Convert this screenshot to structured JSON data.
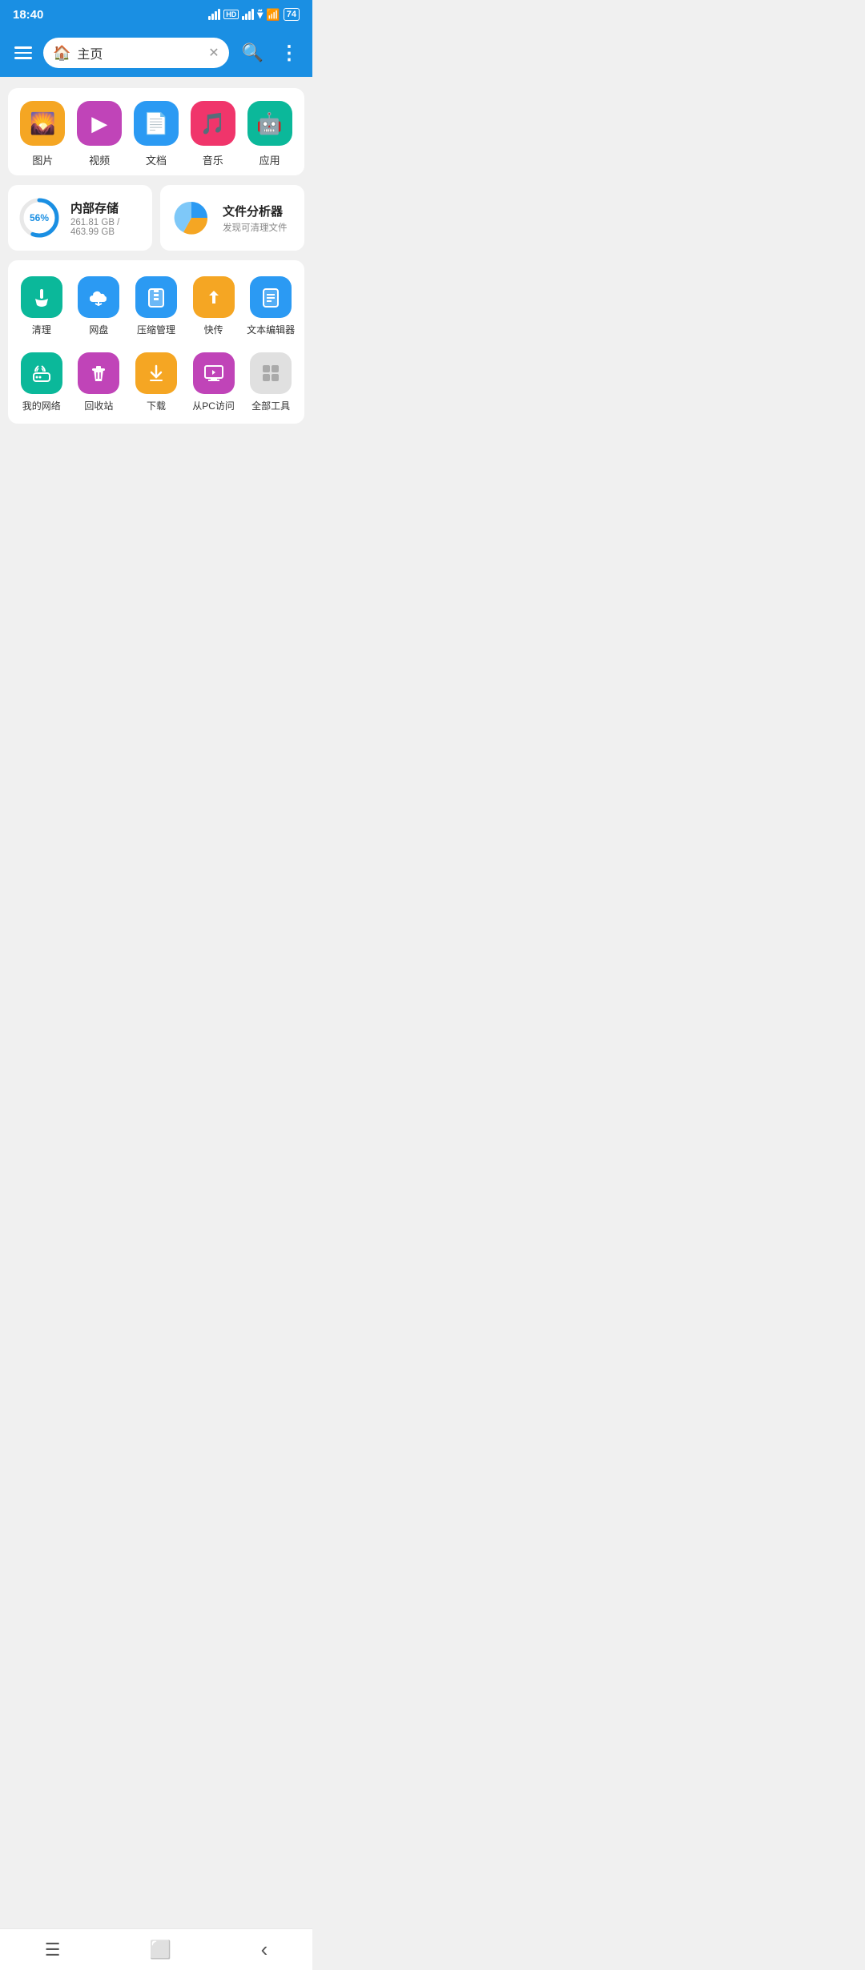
{
  "status": {
    "time": "18:40",
    "battery": "74"
  },
  "header": {
    "menu_label": "menu",
    "home_icon": "🏠",
    "home_label": "主页",
    "close_icon": "✕",
    "search_icon": "🔍",
    "more_icon": "⋮"
  },
  "file_types": [
    {
      "id": "images",
      "label": "图片",
      "icon": "🌄",
      "bg": "#F5A623"
    },
    {
      "id": "video",
      "label": "视频",
      "icon": "▶",
      "bg": "#C044B8"
    },
    {
      "id": "docs",
      "label": "文档",
      "icon": "📄",
      "bg": "#2B9AF3"
    },
    {
      "id": "music",
      "label": "音乐",
      "icon": "♪",
      "bg": "#F0356B"
    },
    {
      "id": "apps",
      "label": "应用",
      "icon": "🤖",
      "bg": "#0BB89A"
    }
  ],
  "storage": {
    "title": "内部存储",
    "used": "261.81 GB",
    "total": "463.99 GB",
    "sub": "261.81 GB / 463.99 GB",
    "pct": "56%",
    "pct_num": 56
  },
  "analyzer": {
    "title": "文件分析器",
    "sub": "发现可清理文件"
  },
  "tools": [
    {
      "id": "clean",
      "label": "清理",
      "icon": "🔧",
      "bg": "#0BB89A"
    },
    {
      "id": "cloud",
      "label": "网盘",
      "icon": "☁",
      "bg": "#2B9AF3"
    },
    {
      "id": "zip",
      "label": "压缩管理",
      "icon": "📦",
      "bg": "#2B9AF3"
    },
    {
      "id": "transfer",
      "label": "快传",
      "icon": "✈",
      "bg": "#F5A623"
    },
    {
      "id": "text-editor",
      "label": "文本编辑器",
      "icon": "📝",
      "bg": "#2B9AF3"
    },
    {
      "id": "network",
      "label": "我的网络",
      "icon": "📡",
      "bg": "#0BB89A"
    },
    {
      "id": "recycle",
      "label": "回收站",
      "icon": "🗑",
      "bg": "#C044B8"
    },
    {
      "id": "download",
      "label": "下载",
      "icon": "⬇",
      "bg": "#F5A623"
    },
    {
      "id": "pc-access",
      "label": "从PC访问",
      "icon": "💻",
      "bg": "#C044B8"
    },
    {
      "id": "all-tools",
      "label": "全部工具",
      "icon": "⊞",
      "bg": "#cccccc"
    }
  ],
  "navbar": {
    "menu": "☰",
    "home": "⬜",
    "back": "‹"
  }
}
